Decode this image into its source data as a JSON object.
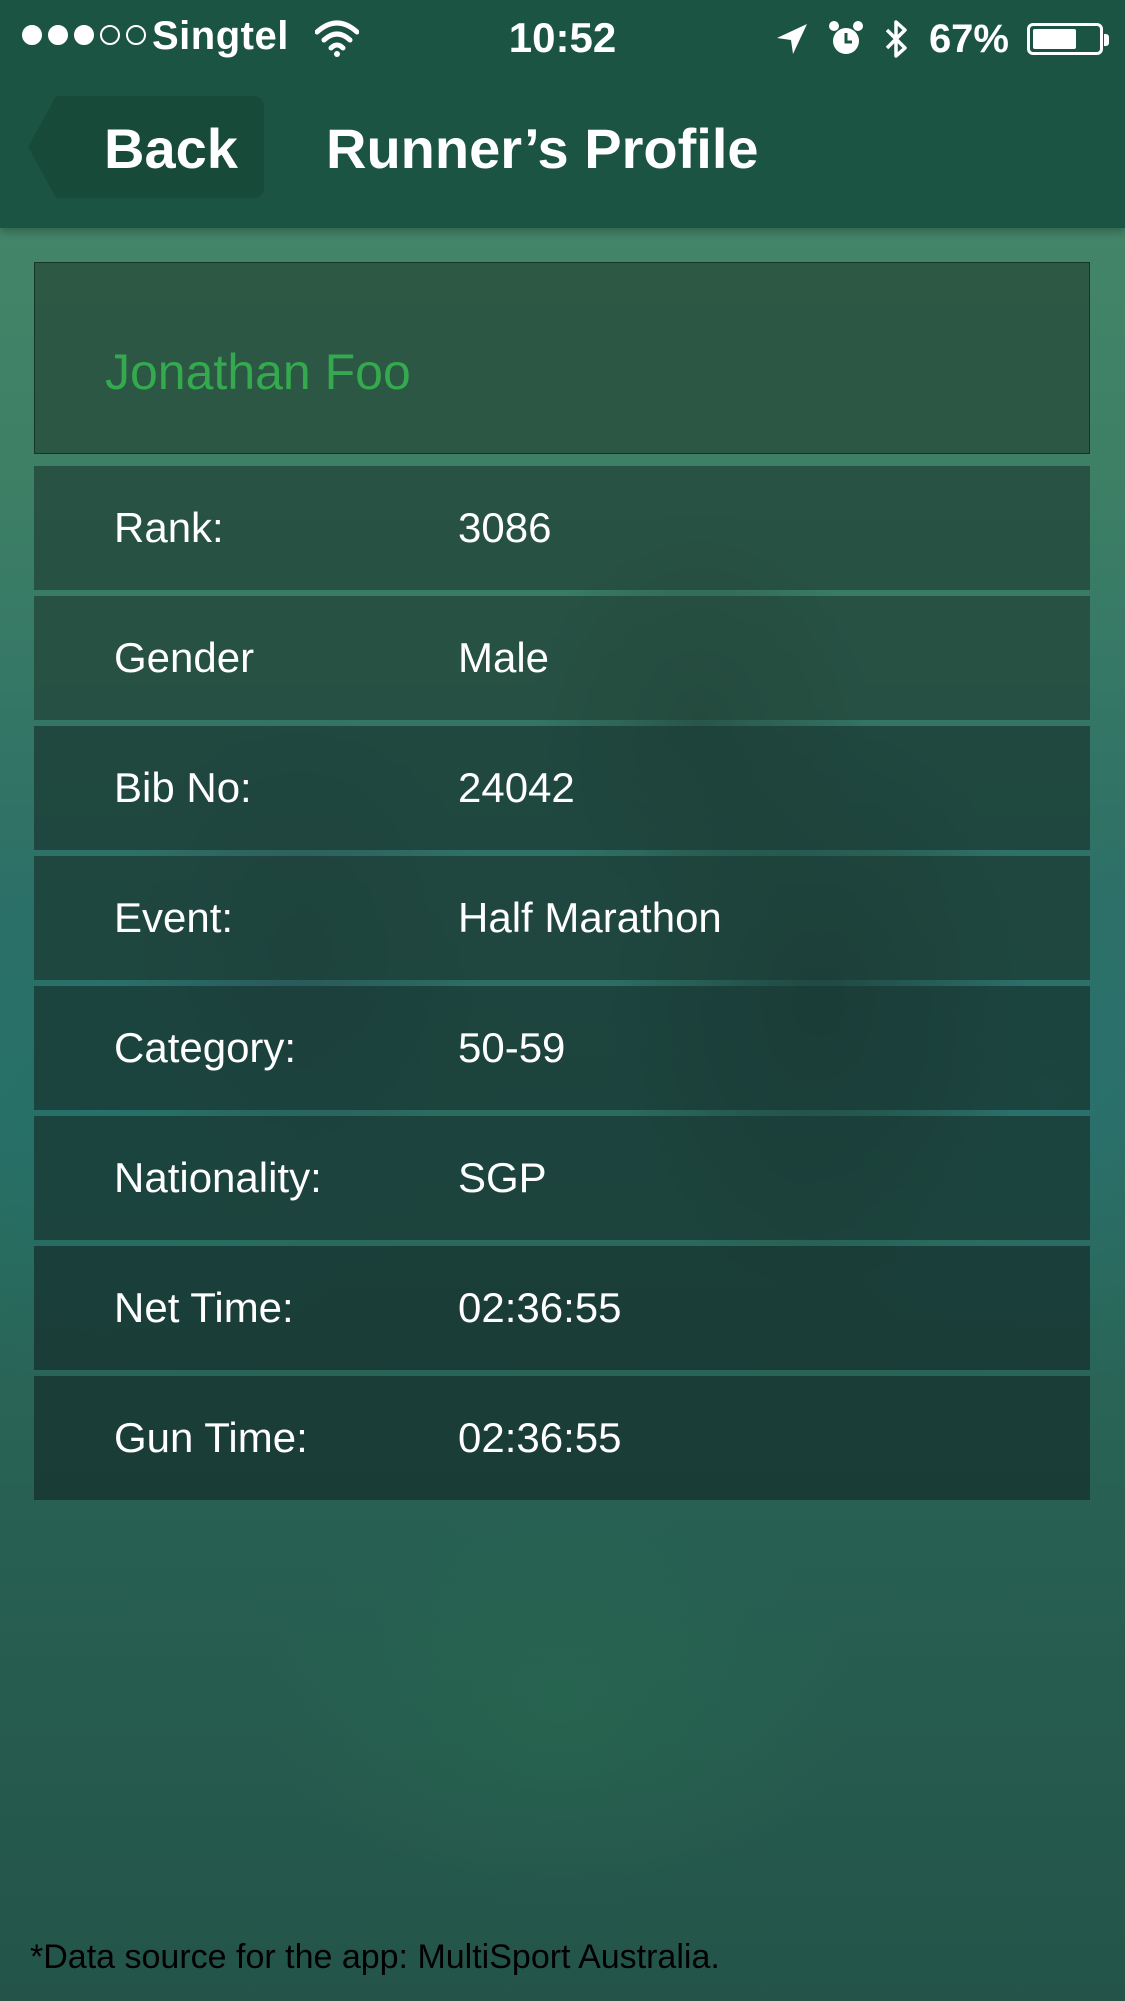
{
  "status_bar": {
    "signal_dots": [
      true,
      true,
      true,
      false,
      false
    ],
    "carrier": "Singtel",
    "time": "10:52",
    "battery_percent": "67%",
    "battery_level": 0.67
  },
  "nav": {
    "back_label": "Back",
    "title": "Runner’s Profile"
  },
  "runner": {
    "name": "Jonathan Foo",
    "name_color": "#35a94e",
    "fields": [
      {
        "label": "Rank:",
        "value": "3086"
      },
      {
        "label": "Gender",
        "value": "Male"
      },
      {
        "label": "Bib No:",
        "value": "24042"
      },
      {
        "label": "Event:",
        "value": "Half Marathon"
      },
      {
        "label": "Category:",
        "value": "50-59"
      },
      {
        "label": "Nationality:",
        "value": "SGP"
      },
      {
        "label": "Net Time:",
        "value": "02:36:55"
      },
      {
        "label": "Gun Time:",
        "value": "02:36:55"
      }
    ]
  },
  "footer": {
    "note": "*Data source for the app: MultiSport Australia."
  },
  "icons": [
    "wifi-icon",
    "location-arrow-icon",
    "alarm-icon",
    "bluetooth-icon",
    "battery-icon",
    "back-chevron-icon"
  ]
}
